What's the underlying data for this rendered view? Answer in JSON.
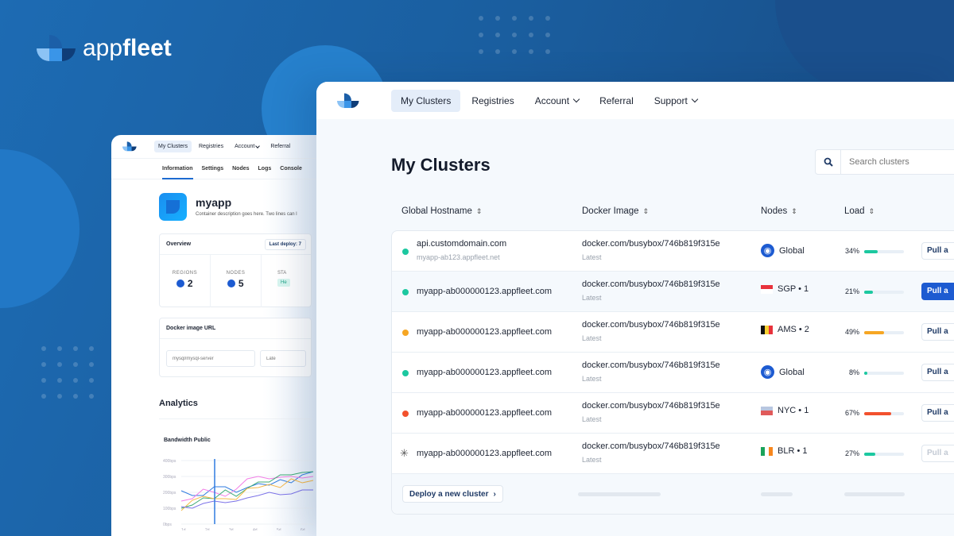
{
  "brand": {
    "name_light": "app",
    "name_bold": "fleet"
  },
  "back_window": {
    "nav": [
      {
        "label": "My Clusters",
        "active": true
      },
      {
        "label": "Registries"
      },
      {
        "label": "Account",
        "dropdown": true
      },
      {
        "label": "Referral"
      }
    ],
    "tabs": [
      {
        "label": "Information",
        "active": true
      },
      {
        "label": "Settings"
      },
      {
        "label": "Nodes"
      },
      {
        "label": "Logs"
      },
      {
        "label": "Console"
      }
    ],
    "app": {
      "name": "myapp",
      "description": "Container description goes here. Two lines can l"
    },
    "overview": {
      "title": "Overview",
      "last_deploy": "Last deploy: 7",
      "stats": [
        {
          "label": "REGIONS",
          "value": "2"
        },
        {
          "label": "NODES",
          "value": "5"
        },
        {
          "label": "STA",
          "badge": "He"
        }
      ]
    },
    "docker": {
      "title": "Docker image URL",
      "image_placeholder": "mysql/mysql-server",
      "tag_placeholder": "Late"
    },
    "analytics": {
      "title": "Analytics"
    }
  },
  "chart_data": {
    "type": "line",
    "title": "Bandwidth Public",
    "y_ticks": [
      "400bps",
      "300bps",
      "200bps",
      "100bps",
      "0bps"
    ],
    "ylim": [
      0,
      400
    ],
    "x_ticks": [
      "1d",
      "2d",
      "3d",
      "4d",
      "5d",
      "6d"
    ],
    "series": [
      {
        "name": "blue",
        "color": "#2f7be0",
        "values": [
          210,
          180,
          180,
          235,
          235,
          200,
          230,
          255,
          245,
          280,
          260,
          310,
          330
        ]
      },
      {
        "name": "pink",
        "color": "#f27ee6",
        "values": [
          145,
          160,
          220,
          200,
          175,
          220,
          285,
          300,
          285,
          295,
          300,
          290,
          300
        ]
      },
      {
        "name": "green",
        "color": "#3caa74",
        "values": [
          100,
          120,
          165,
          160,
          215,
          175,
          225,
          265,
          265,
          310,
          310,
          325,
          330
        ]
      },
      {
        "name": "orange",
        "color": "#f6b948",
        "values": [
          85,
          150,
          175,
          160,
          160,
          155,
          225,
          230,
          250,
          230,
          285,
          260,
          275
        ]
      },
      {
        "name": "purple",
        "color": "#7b72e8",
        "values": [
          110,
          100,
          130,
          145,
          135,
          145,
          165,
          180,
          200,
          185,
          190,
          215,
          215
        ]
      }
    ]
  },
  "main_window": {
    "nav": [
      {
        "label": "My Clusters",
        "active": true
      },
      {
        "label": "Registries"
      },
      {
        "label": "Account",
        "dropdown": true
      },
      {
        "label": "Referral"
      },
      {
        "label": "Support",
        "dropdown": true
      }
    ],
    "title": "My Clusters",
    "search_placeholder": "Search clusters",
    "columns": [
      "Global Hostname",
      "Docker Image",
      "Nodes",
      "Load"
    ],
    "rows": [
      {
        "status": "#1cc8a0",
        "host": "api.customdomain.com",
        "sub": "myapp-ab123.appfleet.net",
        "image": "docker.com/busybox/746b819f315e",
        "tag": "Latest",
        "node": "Global",
        "flag": "globe",
        "load": 34,
        "load_label": "34%",
        "load_color": "#1cc8a0",
        "button": "Pull a",
        "button_style": "default"
      },
      {
        "status": "#1cc8a0",
        "host": "myapp-ab000000123.appfleet.com",
        "image": "docker.com/busybox/746b819f315e",
        "tag": "Latest",
        "node": "SGP • 1",
        "flag": "sg",
        "load": 21,
        "load_label": "21%",
        "load_color": "#1cc8a0",
        "button": "Pull a",
        "button_style": "primary"
      },
      {
        "status": "#f6a623",
        "host": "myapp-ab000000123.appfleet.com",
        "image": "docker.com/busybox/746b819f315e",
        "tag": "Latest",
        "node": "AMS • 2",
        "flag": "be",
        "load": 49,
        "load_label": "49%",
        "load_color": "#f6a623",
        "button": "Pull a",
        "button_style": "default"
      },
      {
        "status": "#1cc8a0",
        "host": "myapp-ab000000123.appfleet.com",
        "image": "docker.com/busybox/746b819f315e",
        "tag": "Latest",
        "node": "Global",
        "flag": "globe",
        "load": 8,
        "load_label": "8%",
        "load_color": "#1cc8a0",
        "button": "Pull a",
        "button_style": "default"
      },
      {
        "status": "#f2512d",
        "host": "myapp-ab000000123.appfleet.com",
        "image": "docker.com/busybox/746b819f315e",
        "tag": "Latest",
        "node": "NYC • 1",
        "flag": "us",
        "load": 67,
        "load_label": "67%",
        "load_color": "#f2512d",
        "button": "Pull a",
        "button_style": "default"
      },
      {
        "status": "loading",
        "host": "myapp-ab000000123.appfleet.com",
        "image": "docker.com/busybox/746b819f315e",
        "tag": "Latest",
        "node": "BLR • 1",
        "flag": "ie",
        "load": 27,
        "load_label": "27%",
        "load_color": "#1cc8a0",
        "button": "Pull a",
        "button_style": "disabled"
      }
    ],
    "deploy_button": "Deploy a new cluster"
  }
}
